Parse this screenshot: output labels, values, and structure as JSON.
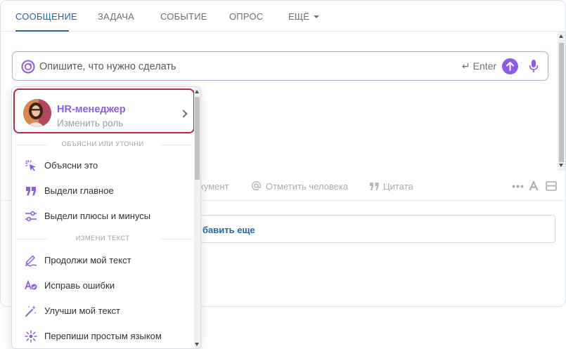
{
  "tabs": {
    "message": "СООБЩЕНИЕ",
    "task": "ЗАДАЧА",
    "event": "СОБЫТИЕ",
    "poll": "ОПРОС",
    "more": "ЕЩЁ"
  },
  "ai_input": {
    "placeholder": "Опишите, что нужно сделать",
    "enter_hint": "↵ Enter",
    "icons": {
      "logo": "copilot-icon",
      "send": "arrow-up-icon",
      "mic": "microphone-icon"
    }
  },
  "toolbar": {
    "document_partial": "кумент",
    "mention": "Отметить человека",
    "quote": "Цитата"
  },
  "add_more": "бавить еще",
  "dropdown": {
    "role": {
      "name": "HR-менеджер",
      "action": "Изменить роль"
    },
    "sections": [
      {
        "title": "ОБЪЯСНИ ИЛИ УТОЧНИ",
        "items": [
          {
            "label": "Объясни это",
            "icon": "cursor-click-icon"
          },
          {
            "label": "Выдели главное",
            "icon": "quote-icon"
          },
          {
            "label": "Выдели плюсы и минусы",
            "icon": "sliders-icon"
          }
        ]
      },
      {
        "title": "ИЗМЕНИ ТЕКСТ",
        "items": [
          {
            "label": "Продолжи мой текст",
            "icon": "pen-signature-icon"
          },
          {
            "label": "Исправь ошибки",
            "icon": "spellcheck-icon"
          },
          {
            "label": "Улучши мой текст",
            "icon": "magic-wand-icon"
          },
          {
            "label": "Перепиши простым языком",
            "icon": "sparkle-icon"
          }
        ]
      }
    ]
  },
  "colors": {
    "accent": "#8d5de8",
    "link": "#2067b0",
    "highlight_border": "#c0283e"
  }
}
